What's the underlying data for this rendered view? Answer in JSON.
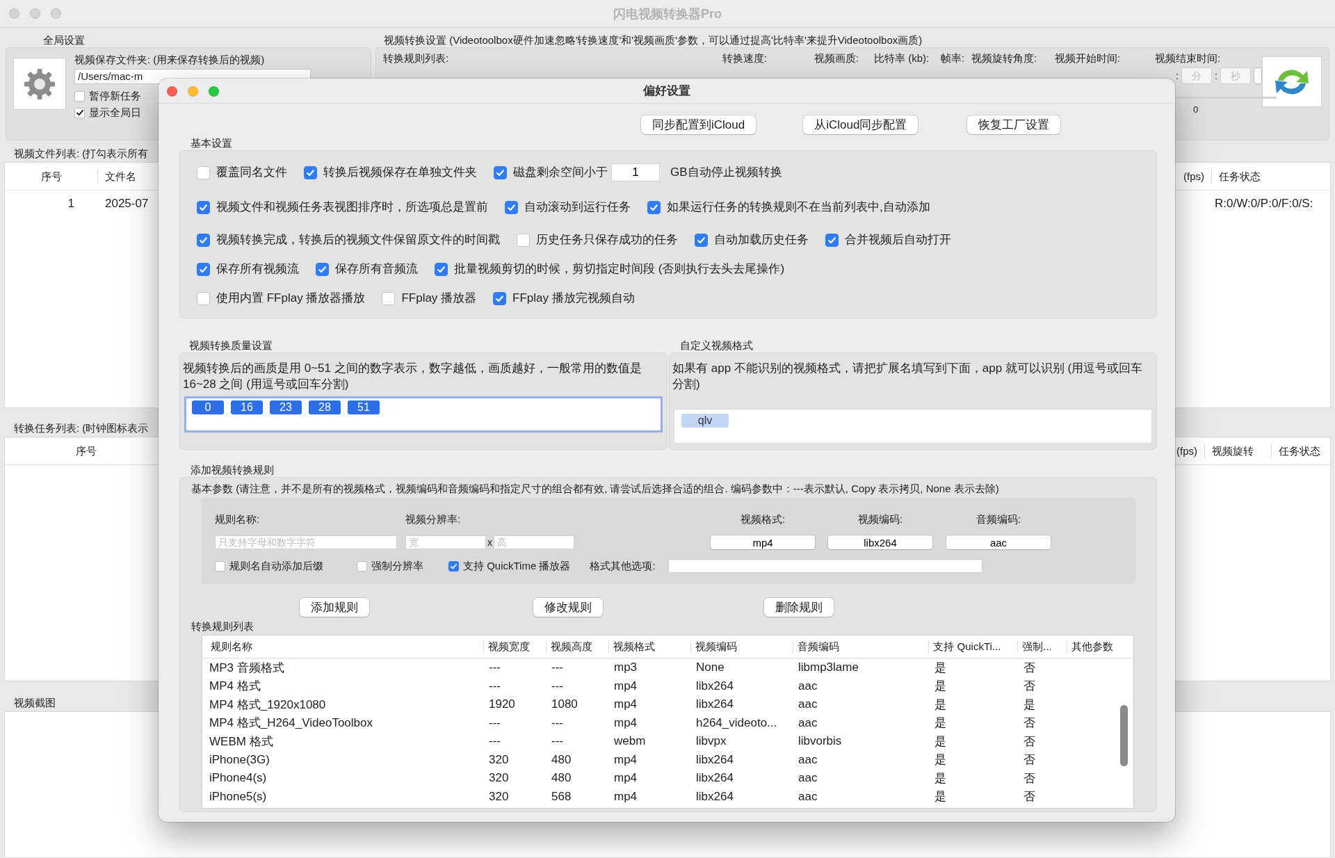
{
  "window": {
    "title": "闪电视频转换器Pro"
  },
  "global_settings": {
    "title": "全局设置",
    "folder_label": "视频保存文件夹: (用来保存转换后的视频)",
    "folder_path": "/Users/mac-m",
    "options": [
      {
        "label": "暂停新任务",
        "checked": false
      },
      {
        "label": "显示全局日",
        "checked": true
      }
    ]
  },
  "conversion_settings": {
    "title": "视频转换设置 (Videotoolbox硬件加速忽略'转换速度'和'视频画质'参数，可以通过提高'比特率'来提升Videotoolbox画质)",
    "labels": [
      "转换规则列表:",
      "转换速度:",
      "视频画质:",
      "比特率 (kb):",
      "帧率:",
      "视频旋转角度:",
      "视频开始时间:",
      "视频结束时间:"
    ],
    "end_time_fields": [
      {
        "separator": ":",
        "placeholder": "分"
      },
      {
        "separator": ":",
        "placeholder": "秒"
      }
    ],
    "progress": {
      "level": 0,
      "reading": "0"
    }
  },
  "file_list": {
    "title": "视频文件列表: (打勾表示所有",
    "columns_left": [
      "序号",
      "文件名"
    ],
    "columns_right": [
      "(fps)",
      "任务状态"
    ],
    "rows": [
      {
        "index": "1",
        "name": "2025-07",
        "status": "R:0/W:0/P:0/F:0/S:"
      }
    ]
  },
  "task_list": {
    "title": "转换任务列表: (时钟图标表示",
    "columns_left": [
      "序号"
    ],
    "columns_right": [
      "(fps)",
      "视频旋转",
      "任务状态"
    ]
  },
  "screenshot_panel": {
    "title": "视频截图"
  },
  "preferences": {
    "title": "偏好设置",
    "sync_buttons": [
      "同步配置到iCloud",
      "从iCloud同步配置",
      "恢复工厂设置"
    ],
    "basic": {
      "title": "基本设置",
      "rows": [
        {
          "items": [
            {
              "kind": "checkbox",
              "label": "覆盖同名文件",
              "checked": false
            },
            {
              "kind": "checkbox",
              "label": "转换后视频保存在单独文件夹",
              "checked": true
            },
            {
              "kind": "threshold",
              "label": "磁盘剩余空间小于",
              "checked": true,
              "value": "1",
              "suffix": "GB自动停止视频转换"
            }
          ]
        },
        {
          "items": [
            {
              "kind": "checkbox",
              "label": "视频文件和视频任务表视图排序时，所选项总是置前",
              "checked": true
            },
            {
              "kind": "checkbox",
              "label": "自动滚动到运行任务",
              "checked": true
            },
            {
              "kind": "checkbox",
              "label": "如果运行任务的转换规则不在当前列表中,自动添加",
              "checked": true
            }
          ]
        },
        {
          "items": [
            {
              "kind": "checkbox",
              "label": "视频转换完成，转换后的视频文件保留原文件的时间戳",
              "checked": true
            },
            {
              "kind": "checkbox",
              "label": "历史任务只保存成功的任务",
              "checked": false
            },
            {
              "kind": "checkbox",
              "label": "自动加载历史任务",
              "checked": true
            },
            {
              "kind": "checkbox",
              "label": "合并视频后自动打开",
              "checked": true
            }
          ]
        },
        {
          "items": [
            {
              "kind": "checkbox",
              "label": "保存所有视频流",
              "checked": true
            },
            {
              "kind": "checkbox",
              "label": "保存所有音频流",
              "checked": true
            },
            {
              "kind": "checkbox",
              "label": "批量视频剪切的时候，剪切指定时间段 (否则执行去头去尾操作)",
              "checked": true
            }
          ]
        },
        {
          "items": [
            {
              "kind": "checkbox",
              "label": "使用内置 FFplay 播放器播放",
              "checked": false
            },
            {
              "kind": "checkbox",
              "label": "FFplay 播放器",
              "checked": false
            },
            {
              "kind": "checkbox",
              "label": "FFplay 播放完视频自动",
              "checked": true
            }
          ]
        }
      ]
    },
    "quality": {
      "title": "视频转换质量设置",
      "description": "视频转换后的画质是用 0~51 之间的数字表示，数字越低，画质越好，一般常用的数值是 16~28 之间 (用逗号或回车分割)",
      "tags": [
        "0",
        "16",
        "23",
        "28",
        "51"
      ]
    },
    "custom_format": {
      "title": "自定义视频格式",
      "description": "如果有 app 不能识别的视频格式，请把扩展名填写到下面，app 就可以识别 (用逗号或回车分割)",
      "tags": [
        "qlv"
      ]
    },
    "add_rule": {
      "title": "添加视频转换规则",
      "note": "基本参数 (请注意，并不是所有的视频格式，视频编码和音频编码和指定尺寸的组合都有效, 请尝试后选择合适的组合. 编码参数中：---表示默认, Copy 表示拷贝, None 表示去除)",
      "name_label": "规则名称:",
      "name_placeholder": "只支持字母和数字字符",
      "resolution_label": "视频分辨率:",
      "width_placeholder": "宽",
      "separator": "x",
      "height_placeholder": "高",
      "selects": [
        {
          "label": "视频格式:",
          "value": "mp4"
        },
        {
          "label": "视频编码:",
          "value": "libx264"
        },
        {
          "label": "音频编码:",
          "value": "aac"
        }
      ],
      "options": [
        {
          "label": "规则名自动添加后缀",
          "checked": false
        },
        {
          "label": "强制分辨率",
          "checked": false
        },
        {
          "label": "支持 QuickTime 播放器",
          "checked": true
        }
      ],
      "other_label": "格式其他选项:",
      "buttons": [
        "添加规则",
        "修改规则",
        "删除规则"
      ],
      "table_title": "转换规则列表",
      "columns": [
        "规则名称",
        "视频宽度",
        "视频高度",
        "视频格式",
        "视频编码",
        "音频编码",
        "支持 QuickTi...",
        "强制...",
        "其他参数"
      ],
      "rows": [
        [
          "MP3 音频格式",
          "---",
          "---",
          "mp3",
          "None",
          "libmp3lame",
          "是",
          "否"
        ],
        [
          "MP4 格式",
          "---",
          "---",
          "mp4",
          "libx264",
          "aac",
          "是",
          "否"
        ],
        [
          "MP4 格式_1920x1080",
          "1920",
          "1080",
          "mp4",
          "libx264",
          "aac",
          "是",
          "是"
        ],
        [
          "MP4 格式_H264_VideoToolbox",
          "---",
          "---",
          "mp4",
          "h264_videoto...",
          "aac",
          "是",
          "否"
        ],
        [
          "WEBM 格式",
          "---",
          "---",
          "webm",
          "libvpx",
          "libvorbis",
          "是",
          "否"
        ],
        [
          "iPhone(3G)",
          "320",
          "480",
          "mp4",
          "libx264",
          "aac",
          "是",
          "否"
        ],
        [
          "iPhone4(s)",
          "320",
          "480",
          "mp4",
          "libx264",
          "aac",
          "是",
          "否"
        ],
        [
          "iPhone5(s)",
          "320",
          "568",
          "mp4",
          "libx264",
          "aac",
          "是",
          "否"
        ]
      ]
    }
  }
}
